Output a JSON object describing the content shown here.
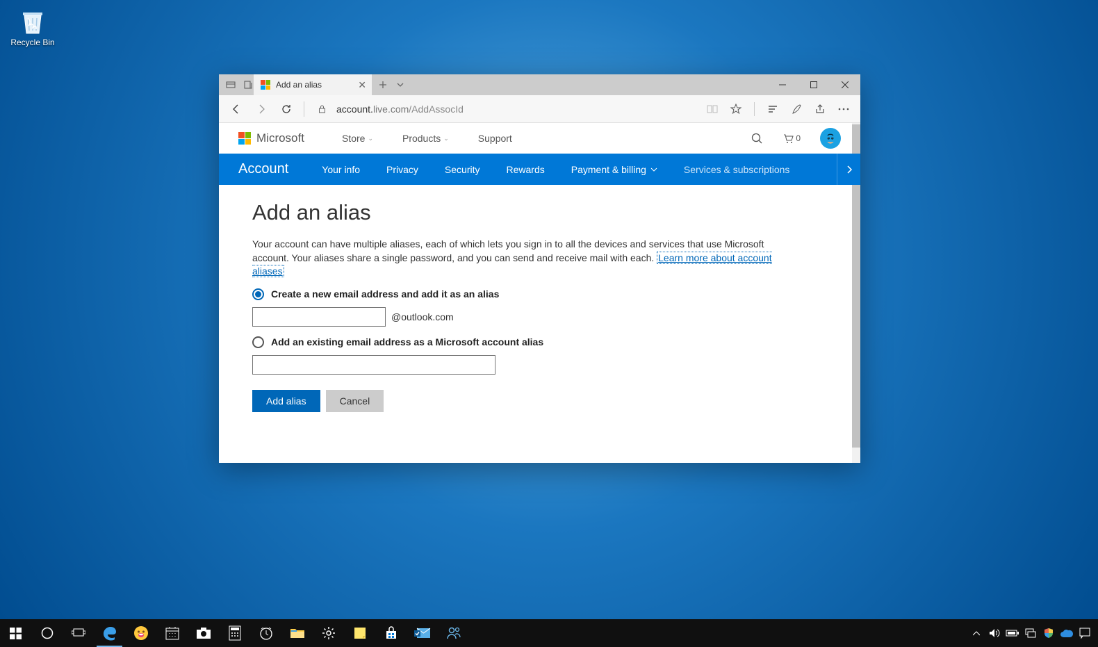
{
  "desktop": {
    "recycle_bin": "Recycle Bin"
  },
  "browser": {
    "tab_title": "Add an alias",
    "url_domain": "account.",
    "url_rest": "live.com/AddAssocId"
  },
  "ms_header": {
    "brand": "Microsoft",
    "links": [
      "Store",
      "Products",
      "Support"
    ],
    "cart_count": "0"
  },
  "subnav": {
    "brand": "Account",
    "items": [
      "Your info",
      "Privacy",
      "Security",
      "Rewards",
      "Payment & billing",
      "Services & subscriptions"
    ]
  },
  "page": {
    "heading": "Add an alias",
    "para": "Your account can have multiple aliases, each of which lets you sign in to all the devices and services that use Microsoft account. Your aliases share a single password, and you can send and receive mail with each. ",
    "link": "Learn more about account aliases",
    "opt1": "Create a new email address and add it as an alias",
    "suffix": "@outlook.com",
    "opt2": "Add an existing email address as a Microsoft account alias",
    "btn_primary": "Add alias",
    "btn_secondary": "Cancel"
  }
}
